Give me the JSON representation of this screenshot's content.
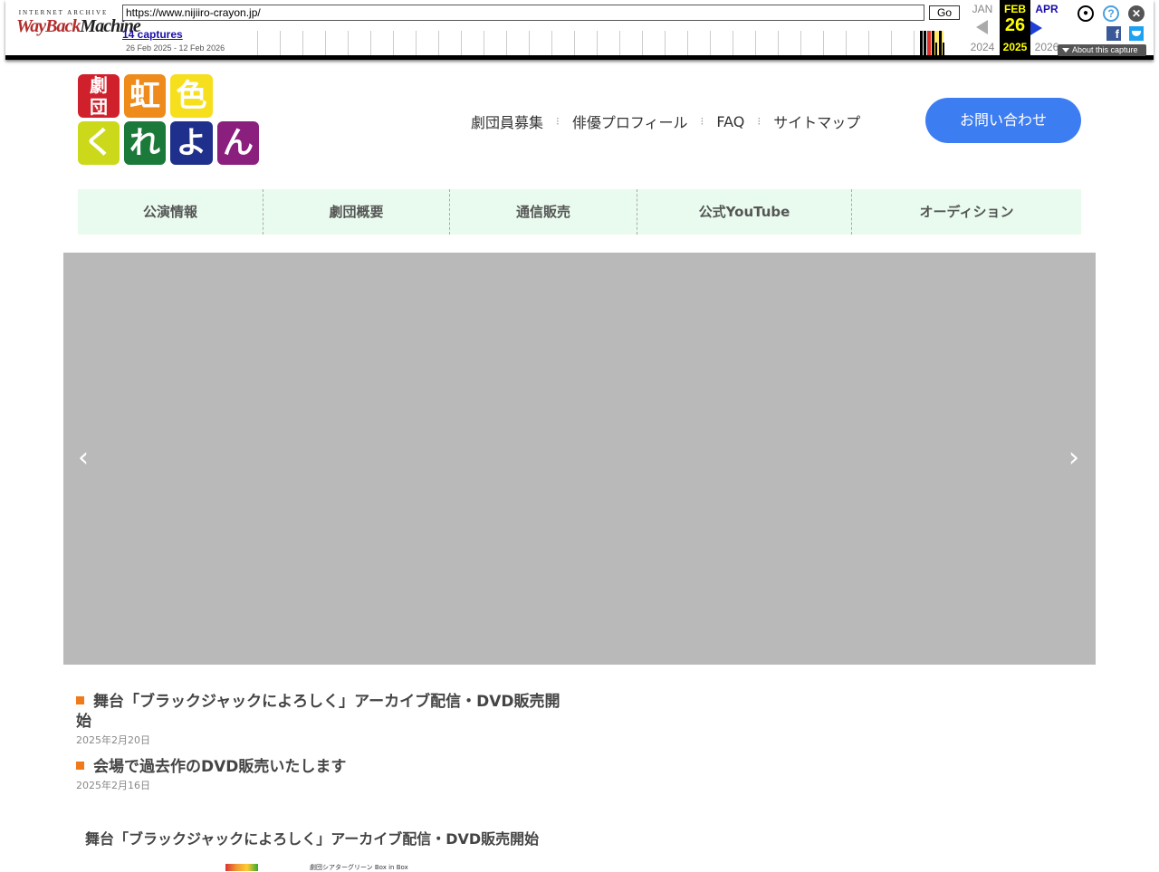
{
  "wayback": {
    "logo_top": "INTERNET ARCHIVE",
    "logo_way": "WayBack",
    "logo_machine": "Machine",
    "url": "https://www.nijiiro-crayon.jp/",
    "go_label": "Go",
    "captures_label": "14 captures",
    "date_range": "26 Feb 2025 - 12 Feb 2026",
    "prev_month": "JAN",
    "prev_year": "2024",
    "cur_month": "FEB",
    "cur_day": "26",
    "cur_year": "2025",
    "next_month": "APR",
    "next_year": "2026",
    "about_label": "About this capture",
    "fb_label": "f"
  },
  "site": {
    "logo": {
      "tile1": "劇",
      "tile2": "団",
      "tile3": "虹",
      "tile4": "色",
      "tile5": "く",
      "tile6": "れ",
      "tile7": "よ",
      "tile8": "ん"
    },
    "top_nav": [
      "劇団員募集",
      "俳優プロフィール",
      "FAQ",
      "サイトマップ"
    ],
    "top_nav_separator": "⁝",
    "contact_label": "お問い合わせ",
    "global_nav": [
      "公演情報",
      "劇団概要",
      "通信販売",
      "公式YouTube",
      "オーディション"
    ],
    "slider_prev": "‹",
    "slider_next": "›",
    "news": [
      {
        "title": "舞台「ブラックジャックによろしく」アーカイブ配信・DVD販売開始",
        "date": "2025年2月20日"
      },
      {
        "title": "会場で過去作のDVD販売いたします",
        "date": "2025年2月16日"
      }
    ],
    "article_title": "舞台「ブラックジャックによろしく」アーカイブ配信・DVD販売開始",
    "article_thumb_text": "劇団シアターグリーン Box in Box"
  },
  "colors": {
    "accent": "#3d7df2",
    "gnav_bg": "#e9fbee",
    "news_bullet": "#f07a1a",
    "slider_bg": "#b9b9b9"
  }
}
